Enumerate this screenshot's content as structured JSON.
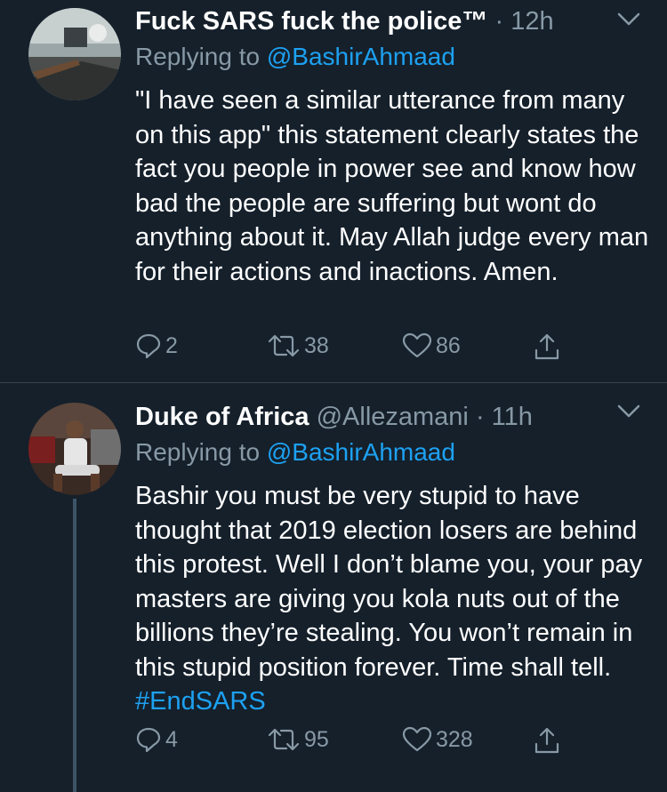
{
  "tweets": [
    {
      "name": "Fuck SARS fuck the police™",
      "handle": "",
      "dot": "·",
      "time": "12h",
      "replying_prefix": "Replying to ",
      "replying_to": "@BashirAhmaad",
      "text": "\"I have seen a similar utterance from many on this app\" this statement clearly states the fact you people in power see and know how bad the people are suffering but wont do anything about it. May Allah judge every man for their actions and inactions. Amen.",
      "hashtag": "",
      "replies": "2",
      "retweets": "38",
      "likes": "86"
    },
    {
      "name": "Duke of Africa",
      "handle": "@Allezamani",
      "dot": "·",
      "time": "11h",
      "replying_prefix": "Replying to ",
      "replying_to": "@BashirAhmaad",
      "text": "Bashir you must be very stupid to have thought that 2019 election losers are behind this protest. Well I don’t blame you, your pay masters are giving you kola nuts out of the billions they’re stealing. You won’t remain in this stupid position forever. Time shall tell. ",
      "hashtag": "#EndSARS",
      "replies": "4",
      "retweets": "95",
      "likes": "328"
    }
  ],
  "icons": [
    "reply-icon",
    "retweet-icon",
    "like-icon",
    "share-icon",
    "chevron-down-icon"
  ],
  "colors": {
    "background": "#15202b",
    "text": "#ffffff",
    "muted": "#8899a6",
    "link": "#1da1f2",
    "divider": "#38444d"
  }
}
